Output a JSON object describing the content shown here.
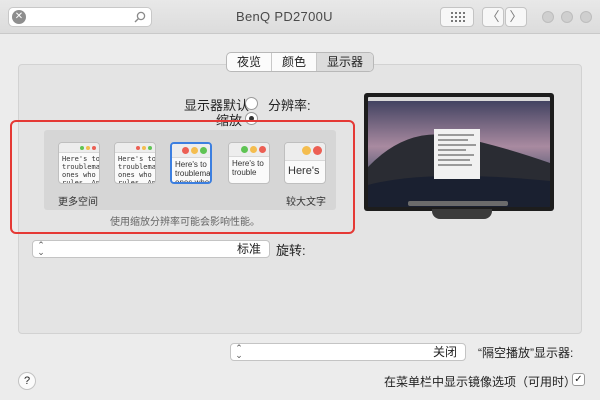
{
  "window": {
    "title": "BenQ PD2700U"
  },
  "toolbar": {
    "clear_icon": "clear-icon",
    "search_icon": "magnifier-icon",
    "grid_icon": "grid-icon",
    "back_label": "〈",
    "forward_label": "〉"
  },
  "tabs": [
    {
      "label": "夜览",
      "selected": false
    },
    {
      "label": "颜色",
      "selected": false
    },
    {
      "label": "显示器",
      "selected": true
    }
  ],
  "resolution": {
    "label": "分辨率:",
    "options": [
      {
        "label": "显示器默认",
        "selected": false
      },
      {
        "label": "缩放",
        "selected": true
      }
    ]
  },
  "scaling": {
    "thumbs": [
      {
        "text": "Here's"
      },
      {
        "text": "Here's to\ntrouble"
      },
      {
        "text": "Here's to\ntroublema\nones who"
      },
      {
        "text": "Here's to the cr\ntroublemakers.\nones who see th\nrules. And they"
      },
      {
        "text": "Here's to the crazy\ntroublemakers. The\nones who see things\nrules. And they have"
      }
    ],
    "left_label": "较大文字",
    "right_label": "更多空间",
    "note": "使用缩放分辨率可能会影响性能。"
  },
  "rotation": {
    "label": "旋转:",
    "value": "标准",
    "arrows": "⌃⌄"
  },
  "airplay": {
    "label": "“隔空播放”显示器:",
    "value": "关闭"
  },
  "mirroring": {
    "label": "在菜单栏中显示镜像选项（可用时）",
    "checked": true,
    "check_glyph": "✓"
  },
  "help": {
    "label": "?"
  },
  "colors": {
    "accent": "#3c7fe0",
    "highlight": "#e53935",
    "red": "#ec5f54",
    "yellow": "#f4bd4f",
    "green": "#5fc454"
  }
}
